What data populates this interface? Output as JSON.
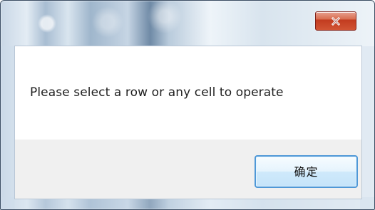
{
  "dialog": {
    "message": "Please select a row or any cell to operate",
    "ok_label": "确定",
    "close_icon": "close-icon"
  }
}
